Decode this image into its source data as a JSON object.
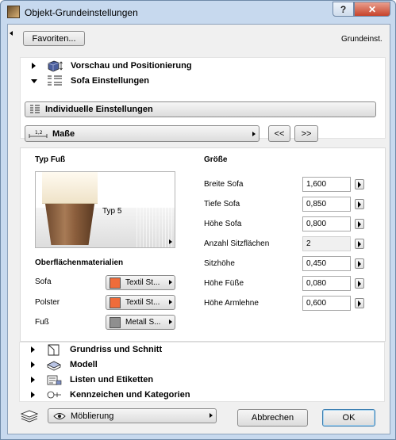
{
  "window": {
    "title": "Objekt-Grundeinstellungen"
  },
  "titlebar": {
    "help_glyph": "?",
    "close_glyph": "✕"
  },
  "top": {
    "favorites_label": "Favoriten...",
    "context_label": "Grundeinst."
  },
  "sections": {
    "preview": "Vorschau und Positionierung",
    "sofa": "Sofa Einstellungen",
    "floorplan": "Grundriss und Schnitt",
    "model": "Modell",
    "lists": "Listen und Etiketten",
    "tags": "Kennzeichen und Kategorien"
  },
  "individual_label": "Individuelle Einstellungen",
  "page_select": {
    "label": "Maße",
    "prev": "<<",
    "next": ">>"
  },
  "leg": {
    "title": "Typ Fuß",
    "type_label": "Typ 5"
  },
  "surfaces": {
    "title": "Oberflächenmaterialien",
    "items": [
      {
        "label": "Sofa",
        "material": "Textil St...",
        "color": "#ef6c3a"
      },
      {
        "label": "Polster",
        "material": "Textil St...",
        "color": "#ef6c3a"
      },
      {
        "label": "Fuß",
        "material": "Metall S...",
        "color": "#8f8f8f"
      }
    ]
  },
  "size": {
    "title": "Größe",
    "params": [
      {
        "label": "Breite Sofa",
        "value": "1,600"
      },
      {
        "label": "Tiefe Sofa",
        "value": "0,850"
      },
      {
        "label": "Höhe Sofa",
        "value": "0,800"
      },
      {
        "label": "Anzahl Sitzflächen",
        "value": "2"
      },
      {
        "label": "Sitzhöhe",
        "value": "0,450"
      },
      {
        "label": "Höhe Füße",
        "value": "0,080"
      },
      {
        "label": "Höhe Armlehne",
        "value": "0,600"
      }
    ]
  },
  "bottom": {
    "layer": "Möblierung",
    "cancel": "Abbrechen",
    "ok": "OK"
  },
  "colors": {
    "titlebar": "#c7d9ee",
    "close": "#c7432b",
    "ok_border": "#3c7fb1"
  }
}
